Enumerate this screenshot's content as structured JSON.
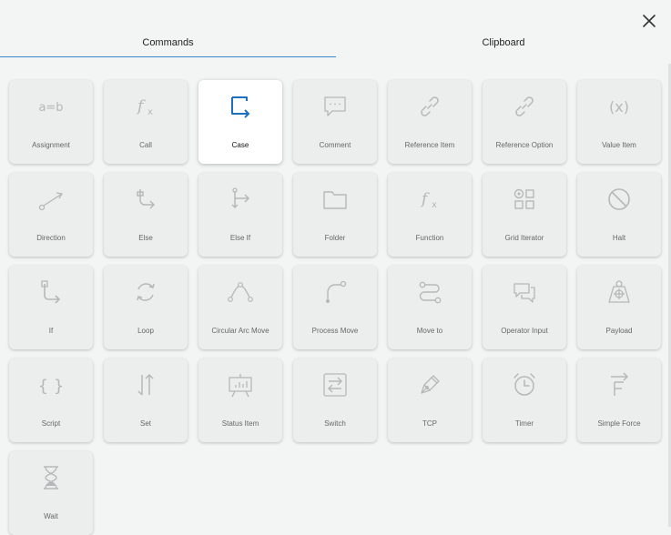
{
  "tabs": [
    {
      "label": "Commands",
      "active": true
    },
    {
      "label": "Clipboard",
      "active": false
    }
  ],
  "colors": {
    "accent": "#3a86c8",
    "icon": "#b4b8b8",
    "selected_icon": "#1f6fbf"
  },
  "commands": [
    {
      "label": "Assignment",
      "icon": "assignment-icon"
    },
    {
      "label": "Call",
      "icon": "function-icon"
    },
    {
      "label": "Case",
      "icon": "case-icon",
      "selected": true
    },
    {
      "label": "Comment",
      "icon": "comment-icon"
    },
    {
      "label": "Reference Item",
      "icon": "link-icon"
    },
    {
      "label": "Reference Option",
      "icon": "link-icon"
    },
    {
      "label": "Value Item",
      "icon": "variable-icon"
    },
    {
      "label": "Direction",
      "icon": "direction-icon"
    },
    {
      "label": "Else",
      "icon": "else-icon"
    },
    {
      "label": "Else If",
      "icon": "else-if-icon"
    },
    {
      "label": "Folder",
      "icon": "folder-icon"
    },
    {
      "label": "Function",
      "icon": "function-icon"
    },
    {
      "label": "Grid Iterator",
      "icon": "grid-icon"
    },
    {
      "label": "Halt",
      "icon": "halt-icon"
    },
    {
      "label": "If",
      "icon": "if-icon"
    },
    {
      "label": "Loop",
      "icon": "loop-icon"
    },
    {
      "label": "Circular Arc Move",
      "icon": "arc-icon"
    },
    {
      "label": "Process Move",
      "icon": "process-move-icon"
    },
    {
      "label": "Move to",
      "icon": "move-to-icon"
    },
    {
      "label": "Operator Input",
      "icon": "operator-input-icon"
    },
    {
      "label": "Payload",
      "icon": "payload-icon"
    },
    {
      "label": "Script",
      "icon": "script-icon"
    },
    {
      "label": "Set",
      "icon": "set-icon"
    },
    {
      "label": "Status Item",
      "icon": "status-icon"
    },
    {
      "label": "Switch",
      "icon": "switch-icon"
    },
    {
      "label": "TCP",
      "icon": "tcp-icon"
    },
    {
      "label": "Timer",
      "icon": "timer-icon"
    },
    {
      "label": "Simple Force",
      "icon": "force-icon"
    },
    {
      "label": "Wait",
      "icon": "hourglass-icon"
    }
  ]
}
